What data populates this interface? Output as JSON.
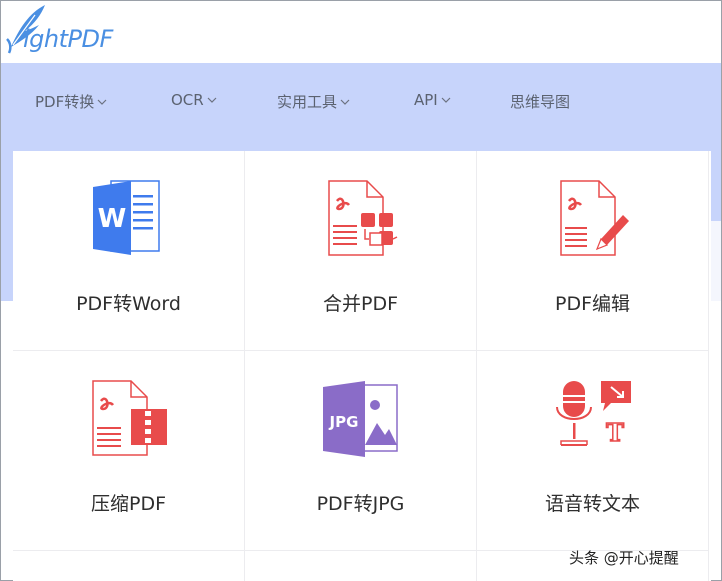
{
  "brand": {
    "logo_text": "ightPDF"
  },
  "nav": [
    {
      "label": "PDF转换",
      "has_dropdown": true
    },
    {
      "label": "OCR",
      "has_dropdown": true
    },
    {
      "label": "实用工具",
      "has_dropdown": true
    },
    {
      "label": "API",
      "has_dropdown": true
    },
    {
      "label": "思维导图",
      "has_dropdown": false
    }
  ],
  "tools": [
    {
      "label": "PDF转Word",
      "icon": "word-doc-icon"
    },
    {
      "label": "合并PDF",
      "icon": "merge-pdf-icon"
    },
    {
      "label": "PDF编辑",
      "icon": "edit-pdf-icon"
    },
    {
      "label": "压缩PDF",
      "icon": "compress-pdf-icon"
    },
    {
      "label": "PDF转JPG",
      "icon": "jpg-image-icon",
      "icon_text": "JPG"
    },
    {
      "label": "语音转文本",
      "icon": "speech-to-text-icon",
      "icon_text": "T"
    }
  ],
  "watermark": "头条 @开心提醒",
  "colors": {
    "accent": "#4a8fe2",
    "band": "#c7d4fb",
    "pdf_red": "#e84b4b",
    "word_blue": "#3f7bed",
    "jpg_purple": "#8a6cc8"
  }
}
